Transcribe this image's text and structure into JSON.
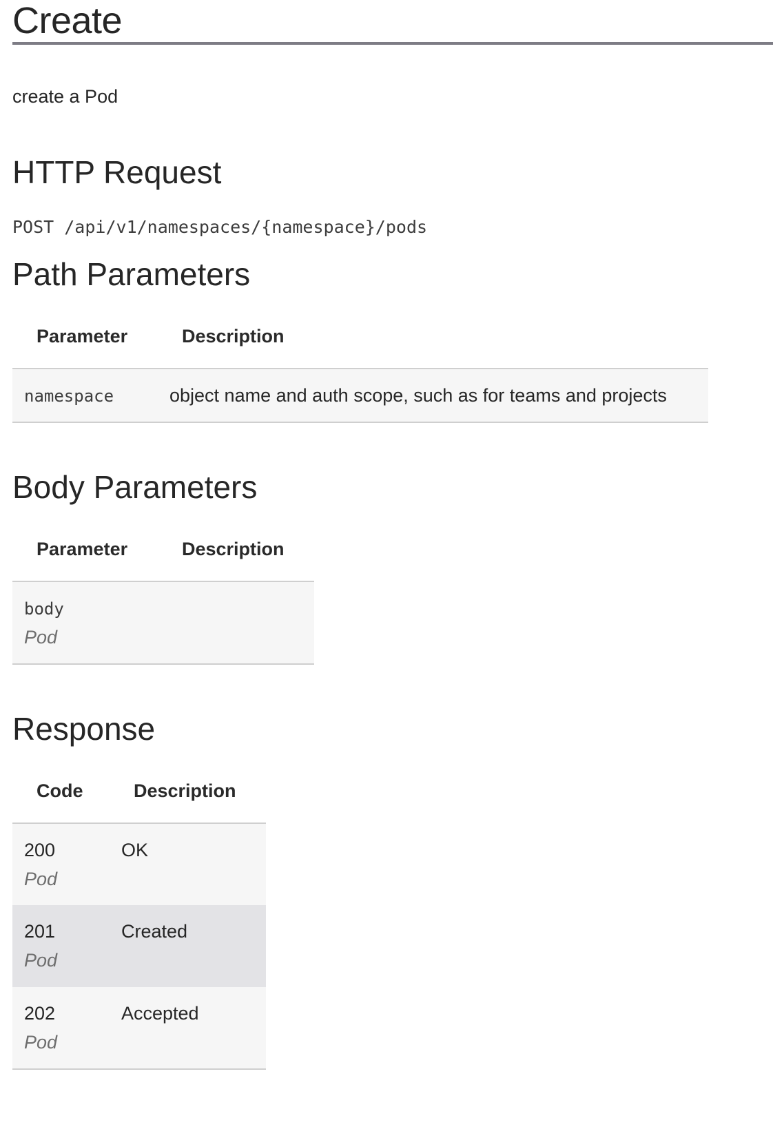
{
  "title": "Create",
  "intro": "create a Pod",
  "http_request": {
    "heading": "HTTP Request",
    "endpoint": "POST /api/v1/namespaces/{namespace}/pods"
  },
  "path_parameters": {
    "heading": "Path Parameters",
    "columns": [
      "Parameter",
      "Description"
    ],
    "rows": [
      {
        "name": "namespace",
        "description": "object name and auth scope, such as for teams and projects"
      }
    ]
  },
  "body_parameters": {
    "heading": "Body Parameters",
    "columns": [
      "Parameter",
      "Description"
    ],
    "rows": [
      {
        "name": "body",
        "type": "Pod",
        "description": ""
      }
    ]
  },
  "response": {
    "heading": "Response",
    "columns": [
      "Code",
      "Description"
    ],
    "rows": [
      {
        "code": "200",
        "type": "Pod",
        "description": "OK"
      },
      {
        "code": "201",
        "type": "Pod",
        "description": "Created"
      },
      {
        "code": "202",
        "type": "Pod",
        "description": "Accepted"
      }
    ]
  }
}
